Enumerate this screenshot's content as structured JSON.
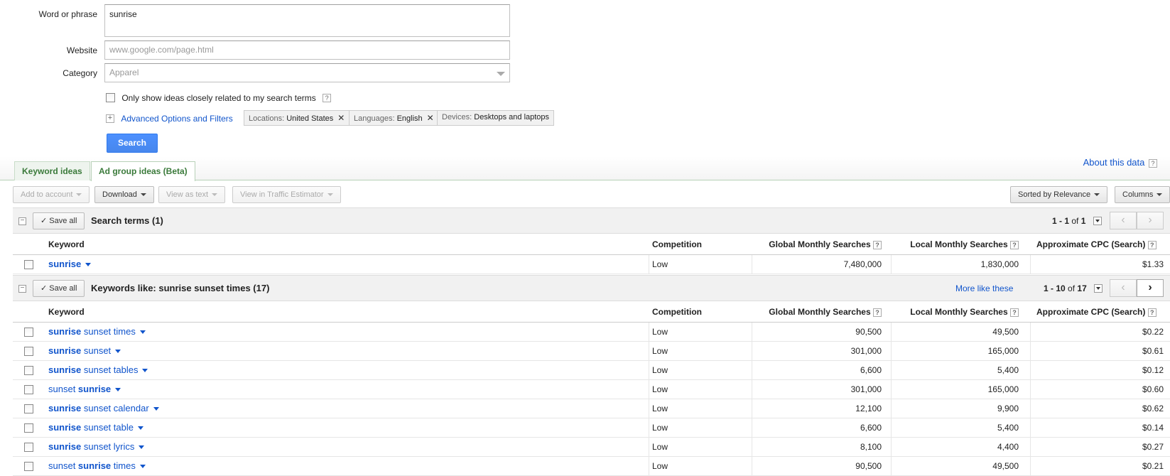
{
  "form": {
    "word_label": "Word or phrase",
    "word_value": "sunrise",
    "website_label": "Website",
    "website_placeholder": "www.google.com/page.html",
    "category_label": "Category",
    "category_value": "Apparel",
    "closely_related_label": "Only show ideas closely related to my search terms",
    "advanced_label": "Advanced Options and Filters",
    "chips": [
      {
        "key": "Locations:",
        "value": "United States",
        "removable": true
      },
      {
        "key": "Languages:",
        "value": "English",
        "removable": true
      },
      {
        "key": "Devices:",
        "value": "Desktops and laptops",
        "removable": false
      }
    ],
    "search_button": "Search"
  },
  "tabs": [
    {
      "label": "Keyword ideas",
      "active": false
    },
    {
      "label": "Ad group ideas (Beta)",
      "active": true
    }
  ],
  "about_label": "About this data",
  "toolbar": {
    "add_to_account": "Add to account",
    "download": "Download",
    "view_as_text": "View as text",
    "view_in_estimator": "View in Traffic Estimator",
    "sorted_by": "Sorted by Relevance",
    "columns": "Columns"
  },
  "columns": {
    "keyword": "Keyword",
    "competition": "Competition",
    "global": "Global Monthly Searches",
    "local": "Local Monthly Searches",
    "cpc": "Approximate CPC (Search)"
  },
  "search_terms": {
    "save_all": "Save all",
    "title": "Search terms (1)",
    "pager_range": "1 - 1",
    "pager_of": "of",
    "pager_total": "1",
    "rows": [
      {
        "parts": [
          {
            "t": "sunrise",
            "b": true
          }
        ],
        "competition": "Low",
        "global": "7,480,000",
        "local": "1,830,000",
        "cpc": "$1.33"
      }
    ]
  },
  "keywords_like": {
    "save_all": "Save all",
    "title": "Keywords like: sunrise sunset times (17)",
    "more_like": "More like these",
    "pager_range": "1 - 10",
    "pager_of": "of",
    "pager_total": "17",
    "rows": [
      {
        "parts": [
          {
            "t": "sunrise",
            "b": true
          },
          {
            "t": " sunset times",
            "b": false
          }
        ],
        "competition": "Low",
        "global": "90,500",
        "local": "49,500",
        "cpc": "$0.22"
      },
      {
        "parts": [
          {
            "t": "sunrise",
            "b": true
          },
          {
            "t": " sunset",
            "b": false
          }
        ],
        "competition": "Low",
        "global": "301,000",
        "local": "165,000",
        "cpc": "$0.61"
      },
      {
        "parts": [
          {
            "t": "sunrise",
            "b": true
          },
          {
            "t": " sunset tables",
            "b": false
          }
        ],
        "competition": "Low",
        "global": "6,600",
        "local": "5,400",
        "cpc": "$0.12"
      },
      {
        "parts": [
          {
            "t": "sunset ",
            "b": false
          },
          {
            "t": "sunrise",
            "b": true
          }
        ],
        "competition": "Low",
        "global": "301,000",
        "local": "165,000",
        "cpc": "$0.60"
      },
      {
        "parts": [
          {
            "t": "sunrise",
            "b": true
          },
          {
            "t": " sunset calendar",
            "b": false
          }
        ],
        "competition": "Low",
        "global": "12,100",
        "local": "9,900",
        "cpc": "$0.62"
      },
      {
        "parts": [
          {
            "t": "sunrise",
            "b": true
          },
          {
            "t": " sunset table",
            "b": false
          }
        ],
        "competition": "Low",
        "global": "6,600",
        "local": "5,400",
        "cpc": "$0.14"
      },
      {
        "parts": [
          {
            "t": "sunrise",
            "b": true
          },
          {
            "t": " sunset lyrics",
            "b": false
          }
        ],
        "competition": "Low",
        "global": "8,100",
        "local": "4,400",
        "cpc": "$0.27"
      },
      {
        "parts": [
          {
            "t": "sunset ",
            "b": false
          },
          {
            "t": "sunrise",
            "b": true
          },
          {
            "t": " times",
            "b": false
          }
        ],
        "competition": "Low",
        "global": "90,500",
        "local": "49,500",
        "cpc": "$0.21"
      }
    ]
  }
}
